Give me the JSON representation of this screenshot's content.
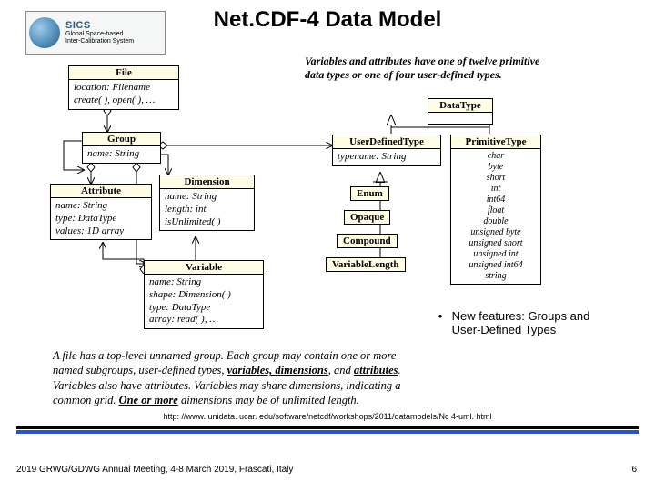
{
  "page_title": "Net.CDF-4 Data Model",
  "logo": {
    "brand": "SICS",
    "line1": "Global Space-based",
    "line2": "Inter-Calibration System"
  },
  "head_note": "Variables and attributes have one of twelve primitive data types or one of four user-defined types.",
  "uml": {
    "file": {
      "title": "File",
      "lines": [
        "location: Filename",
        "create( ), open( ), …"
      ]
    },
    "group": {
      "title": "Group",
      "lines": [
        "name: String"
      ]
    },
    "attribute": {
      "title": "Attribute",
      "lines": [
        "name: String",
        "type: DataType",
        "values: 1D array"
      ]
    },
    "dimension": {
      "title": "Dimension",
      "lines": [
        "name: String",
        "length: int",
        "isUnlimited( )"
      ]
    },
    "variable": {
      "title": "Variable",
      "lines": [
        "name: String",
        "shape: Dimension( )",
        "type: DataType",
        "array: read( ), …"
      ]
    },
    "datatype": {
      "title": "DataType",
      "lines": []
    },
    "userdef": {
      "title": "UserDefinedType",
      "lines": [
        "typename: String"
      ]
    },
    "primitive": {
      "title": "PrimitiveType",
      "lines": [
        "char",
        "byte",
        "short",
        "int",
        "int64",
        "float",
        "double",
        "unsigned byte",
        "unsigned short",
        "unsigned int",
        "unsigned int64",
        "string"
      ]
    },
    "enum": "Enum",
    "opaque": "Opaque",
    "compound": "Compound",
    "varlen": "VariableLength"
  },
  "new_features": {
    "bullet": "•",
    "text": "New features: Groups and User-Defined Types"
  },
  "footnote": {
    "l1": "A file has a top-level unnamed group. Each group may contain one or more",
    "l2": "named subgroups, user-defined types, variables, dimensions, and attributes.",
    "l3": "Variables also have attributes. Variables may share dimensions, indicating a",
    "l4": "common grid. One or more dimensions may be of unlimited length."
  },
  "url": "http: //www. unidata. ucar. edu/software/netcdf/workshops/2011/datamodels/Nc 4-uml. html",
  "footer": "2019 GRWG/GDWG Annual Meeting, 4-8 March 2019, Frascati, Italy",
  "page_number": "6"
}
